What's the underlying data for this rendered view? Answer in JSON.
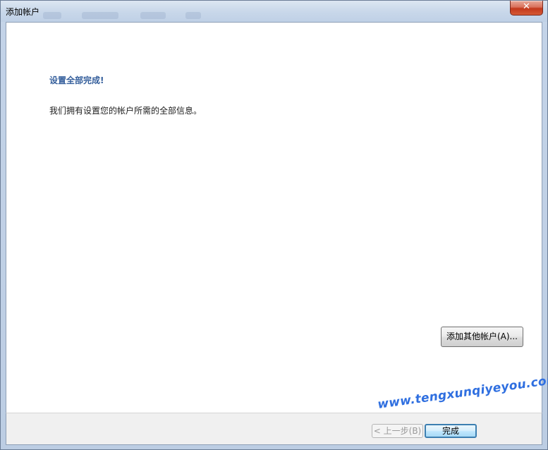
{
  "window": {
    "title": "添加帐户",
    "close_glyph": "✕"
  },
  "main": {
    "heading": "设置全部完成!",
    "message": "我们拥有设置您的帐户所需的全部信息。",
    "add_other_account_label": "添加其他帐户(A)..."
  },
  "footer": {
    "back_label": "< 上一步(B)",
    "finish_label": "完成"
  },
  "watermark": {
    "text": "www.tengxunqiyeyou.com"
  },
  "colors": {
    "heading": "#355f9c",
    "watermark": "#2f6fe0",
    "close_button": "#c2381c"
  }
}
